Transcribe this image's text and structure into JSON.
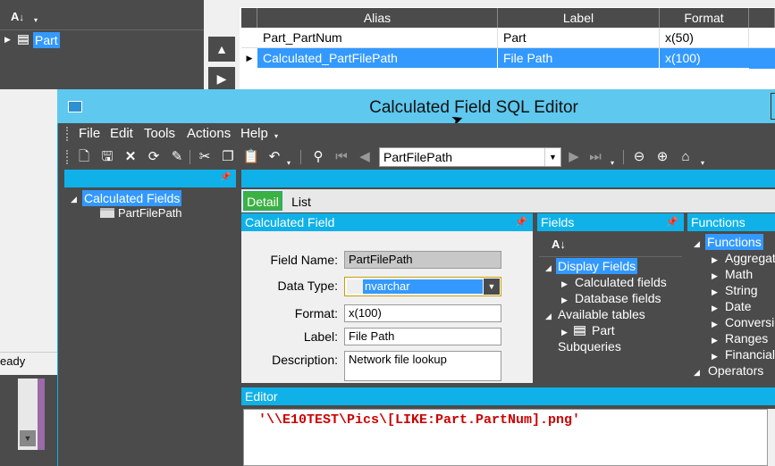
{
  "bg_window": {
    "sort_icon_label": "A↓Z",
    "tree_part_label": "Part",
    "grid": {
      "headers": [
        "Alias",
        "Label",
        "Format"
      ],
      "rows": [
        {
          "alias": "Part_PartNum",
          "label": "Part",
          "format": "x(50)"
        },
        {
          "alias": "Calculated_PartFilePath",
          "label": "File Path",
          "format": "x(100)"
        }
      ]
    },
    "status_text": "eady"
  },
  "dialog": {
    "title": "Calculated Field SQL Editor",
    "menu": [
      "File",
      "Edit",
      "Tools",
      "Actions",
      "Help"
    ],
    "toolbar": {
      "record_value": "PartFilePath"
    },
    "left_tree": {
      "root": "Calculated Fields",
      "child": "PartFilePath"
    },
    "tabs": {
      "detail": "Detail",
      "list": "List"
    },
    "calc_panel": {
      "title": "Calculated Field",
      "field_name_label": "Field Name:",
      "field_name_value": "PartFilePath",
      "data_type_label": "Data Type:",
      "data_type_value": "nvarchar",
      "format_label": "Format:",
      "format_value": "x(100)",
      "label_label": "Label:",
      "label_value": "File Path",
      "description_label": "Description:",
      "description_value": "Network file lookup"
    },
    "fields_panel": {
      "title": "Fields",
      "display_fields": "Display Fields",
      "calculated_fields": "Calculated fields",
      "database_fields": "Database fields",
      "available_tables": "Available tables",
      "part": "Part",
      "subqueries": "Subqueries"
    },
    "functions_panel": {
      "title": "Functions",
      "functions": "Functions",
      "items": [
        "Aggregat",
        "Math",
        "String",
        "Date",
        "Conversi",
        "Ranges",
        "Financial"
      ],
      "operators": "Operators"
    },
    "editor": {
      "title": "Editor",
      "code": "'\\\\E10TEST\\Pics\\[LIKE:Part.PartNum].png'"
    }
  },
  "colors": {
    "accent": "#0fb1e8",
    "selection": "#3399ff",
    "dark": "#4b4b4b",
    "code_red": "#cc0000",
    "detail_tab": "#3bb143"
  }
}
